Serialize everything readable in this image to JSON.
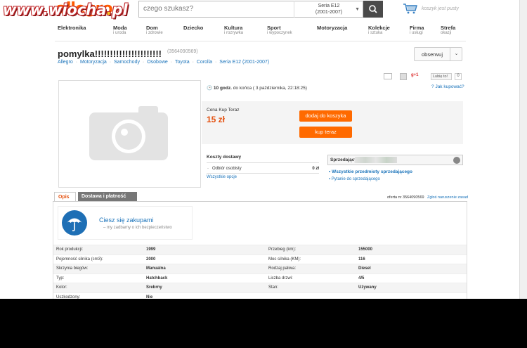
{
  "watermark": {
    "text_main": "www.wiocha",
    "text_dot": ".",
    "text_tld": "pl"
  },
  "header": {
    "logo": "allegro",
    "search_placeholder": "czego szukasz?",
    "category_line1": "Seria E12",
    "category_line2": "(2001-2007)",
    "cart_text": "koszyk jest pusty"
  },
  "nav": [
    {
      "label": "Elektronika",
      "sub": ""
    },
    {
      "label": "Moda",
      "sub": "i uroda"
    },
    {
      "label": "Dom",
      "sub": "i zdrowie"
    },
    {
      "label": "Dziecko",
      "sub": ""
    },
    {
      "label": "Kultura",
      "sub": "i rozrywka"
    },
    {
      "label": "Sport",
      "sub": "i wypoczynek"
    },
    {
      "label": "Motoryzacja",
      "sub": ""
    },
    {
      "label": "Kolekcje",
      "sub": "i sztuka"
    },
    {
      "label": "Firma",
      "sub": "i usługi"
    },
    {
      "label": "Strefa",
      "sub": "okazji"
    }
  ],
  "offer": {
    "title": "pomylka!!!!!!!!!!!!!!!!!!!!!!",
    "id": "(3564090569)",
    "watch_label": "obserwuj",
    "time_bold": "10 godz.",
    "time_rest": " do końca ( 3 października, 22:18:25)",
    "how_buy": "Jak kupować?",
    "buy_now_label": "Cena Kup Teraz",
    "price": "15 zł",
    "add_to_cart": "dodaj do koszyka",
    "buy_now": "kup teraz",
    "share_like": "Lubię to!",
    "share_count": "0",
    "share_gplus": "g+1"
  },
  "breadcrumbs": [
    "Allegro",
    "Motoryzacja",
    "Samochody",
    "Osobowe",
    "Toyota",
    "Corolla",
    "Seria E12 (2001-2007)"
  ],
  "shipping": {
    "title": "Koszty dostawy",
    "row_name": "Odbiór osobisty",
    "row_price": "0 zł",
    "all_options": "Wszystkie opcje"
  },
  "seller": {
    "label": "Sprzedający:",
    "all_items": "Wszystkie przedmioty sprzedającego",
    "ask": "Pytanie do sprzedającego"
  },
  "tabs": {
    "opis": "Opis",
    "dostawa": "Dostawa i płatność"
  },
  "offer_no": "oferta nr 3564090569",
  "report": "Zgłoś naruszenie zasad",
  "enjoy": {
    "title": "Ciesz się zakupami",
    "sub": "– my zadbamy o ich bezpieczeństwo"
  },
  "specs": [
    [
      "Rok produkcji:",
      "1999",
      "Przebieg (km):",
      "155000"
    ],
    [
      "Pojemność silnika (cm3):",
      "2000",
      "Moc silnika (KM):",
      "116"
    ],
    [
      "Skrzynia biegów:",
      "Manualna",
      "Rodzaj paliwa:",
      "Diesel"
    ],
    [
      "Typ:",
      "Hatchback",
      "Liczba drzwi:",
      "4/5"
    ],
    [
      "Kolor:",
      "Srebrny",
      "Stan:",
      "Używany"
    ],
    [
      "Uszkodzony:",
      "Nie",
      "",
      ""
    ]
  ]
}
